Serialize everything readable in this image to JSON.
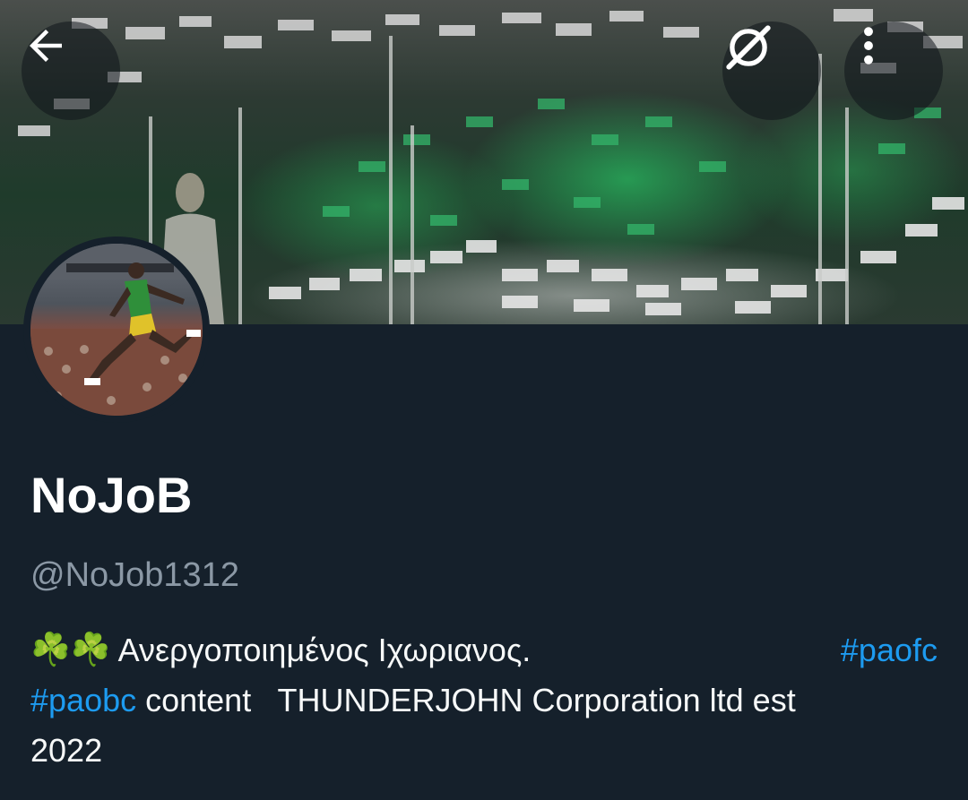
{
  "header": {
    "back_icon": "arrow-left-icon",
    "grok_icon": "grok-icon",
    "more_icon": "more-vertical-icon"
  },
  "profile": {
    "display_name": "NoJoB",
    "handle": "@NoJob1312"
  },
  "bio": {
    "emoji": "☘️☘️",
    "text_1": " Ανεργοποιημένος Ιχωριανος.",
    "hashtag_1": "#paofc",
    "hashtag_2": "#paobc",
    "text_2": " content   THUNDERJOHN Corporation ltd est",
    "text_3": "2022"
  },
  "colors": {
    "background": "#15202b",
    "handle": "#8b98a5",
    "link": "#1d9bf0"
  }
}
